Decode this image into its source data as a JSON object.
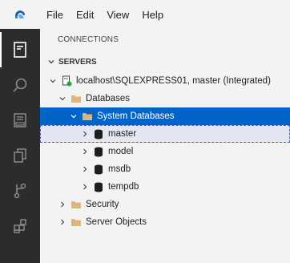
{
  "menubar": {
    "app_icon": "azure-data-studio-logo",
    "items": [
      "File",
      "Edit",
      "View",
      "Help"
    ]
  },
  "activity_bar": {
    "icons": [
      "connections-icon",
      "search-icon",
      "notebooks-icon",
      "extensions-icon",
      "source-control-icon",
      "extensions-marketplace-icon"
    ],
    "active": "connections-icon"
  },
  "panel": {
    "title": "CONNECTIONS",
    "section": "SERVERS",
    "tree": {
      "server": "localhost\\SQLEXPRESS01, master (Integrated)",
      "databases": "Databases",
      "system_databases": "System Databases",
      "dbs": [
        "master",
        "model",
        "msdb",
        "tempdb"
      ],
      "security": "Security",
      "server_objects": "Server Objects"
    }
  },
  "colors": {
    "selection": "#0064c8",
    "folder": "#dcb67a",
    "activity_bar": "#2c2c2c",
    "server_status": "#2ea043"
  }
}
